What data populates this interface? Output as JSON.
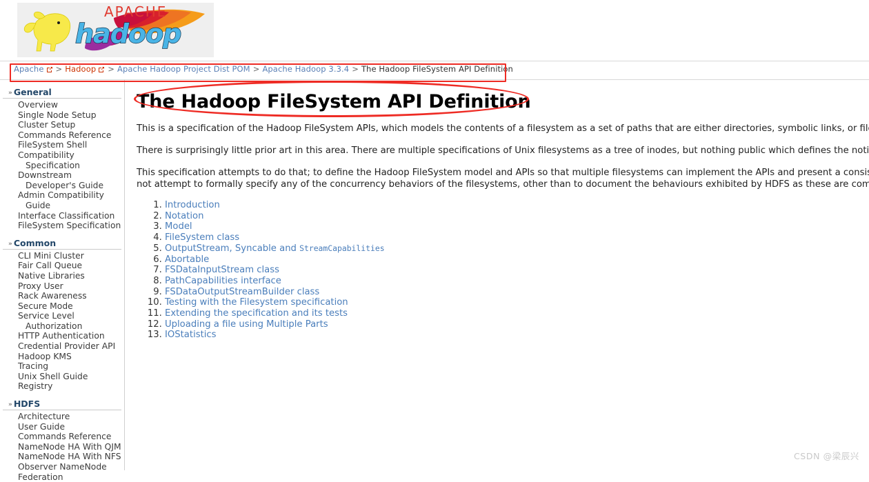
{
  "banner": {
    "logo_alt": "Apache Hadoop",
    "logo_word_apache": "APACHE",
    "logo_word_hadoop": "hadoop",
    "logo_bg": "#efefef",
    "apache_text_color": "#e03a2f",
    "hadoop_text_color": "#4ab4e6",
    "elephant_color": "#f7e94a",
    "feather_colors": [
      "#c8103c",
      "#e8542f",
      "#f59c1a",
      "#f7b733"
    ]
  },
  "breadcrumb": {
    "items": [
      {
        "label": "Apache",
        "style": "blue",
        "external": true
      },
      {
        "label": "Hadoop",
        "style": "red",
        "external": true
      },
      {
        "label": "Apache Hadoop Project Dist POM",
        "style": "blue",
        "external": false
      },
      {
        "label": "Apache Hadoop 3.3.4",
        "style": "blue",
        "external": false
      },
      {
        "label": "The Hadoop FileSystem API Definition",
        "style": "current",
        "external": false
      }
    ],
    "separator": ">",
    "external_icon": "external-link-icon",
    "annotation_color": "#ee2b24"
  },
  "sidebar": {
    "sections": [
      {
        "title": "General",
        "caret": "»",
        "items": [
          {
            "label": "Overview",
            "indent": false
          },
          {
            "label": "Single Node Setup",
            "indent": false
          },
          {
            "label": "Cluster Setup",
            "indent": false
          },
          {
            "label": "Commands Reference",
            "indent": false
          },
          {
            "label": "FileSystem Shell",
            "indent": false
          },
          {
            "label": "Compatibility",
            "indent": false
          },
          {
            "label": "Specification",
            "indent": true
          },
          {
            "label": "Downstream",
            "indent": false
          },
          {
            "label": "Developer's Guide",
            "indent": true
          },
          {
            "label": "Admin Compatibility",
            "indent": false
          },
          {
            "label": "Guide",
            "indent": true
          },
          {
            "label": "Interface Classification",
            "indent": false
          },
          {
            "label": "FileSystem Specification",
            "indent": false
          }
        ]
      },
      {
        "title": "Common",
        "caret": "»",
        "items": [
          {
            "label": "CLI Mini Cluster",
            "indent": false
          },
          {
            "label": "Fair Call Queue",
            "indent": false
          },
          {
            "label": "Native Libraries",
            "indent": false
          },
          {
            "label": "Proxy User",
            "indent": false
          },
          {
            "label": "Rack Awareness",
            "indent": false
          },
          {
            "label": "Secure Mode",
            "indent": false
          },
          {
            "label": "Service Level",
            "indent": false
          },
          {
            "label": "Authorization",
            "indent": true
          },
          {
            "label": "HTTP Authentication",
            "indent": false
          },
          {
            "label": "Credential Provider API",
            "indent": false
          },
          {
            "label": "Hadoop KMS",
            "indent": false
          },
          {
            "label": "Tracing",
            "indent": false
          },
          {
            "label": "Unix Shell Guide",
            "indent": false
          },
          {
            "label": "Registry",
            "indent": false
          }
        ]
      },
      {
        "title": "HDFS",
        "caret": "»",
        "items": [
          {
            "label": "Architecture",
            "indent": false
          },
          {
            "label": "User Guide",
            "indent": false
          },
          {
            "label": "Commands Reference",
            "indent": false
          },
          {
            "label": "NameNode HA With QJM",
            "indent": false
          },
          {
            "label": "NameNode HA With NFS",
            "indent": false
          },
          {
            "label": "Observer NameNode",
            "indent": false
          },
          {
            "label": "Federation",
            "indent": false
          }
        ]
      }
    ]
  },
  "main": {
    "title": "The Hadoop FileSystem API Definition",
    "title_annotation_color": "#ee2b24",
    "paragraphs": [
      "This is a specification of the Hadoop FileSystem APIs, which models the contents of a filesystem as a set of paths that are either directories, symbolic links, or files.",
      "There is surprisingly little prior art in this area. There are multiple specifications of Unix filesystems as a tree of inodes, but nothing public which defines the notion of “Unix filesystem as a tree of inodes”.",
      "This specification attempts to do that; to define the Hadoop FileSystem model and APIs so that multiple filesystems can implement the APIs and present a consistent model of their data to applications. It does not attempt to formally specify any of the concurrency behaviors of the filesystems, other than to document the behaviours exhibited by HDFS as these are commonly expected by Hadoop client applications."
    ],
    "toc": [
      {
        "num": 1,
        "text": "Introduction",
        "code": ""
      },
      {
        "num": 2,
        "text": "Notation",
        "code": ""
      },
      {
        "num": 3,
        "text": "Model",
        "code": ""
      },
      {
        "num": 4,
        "text": "FileSystem class",
        "code": ""
      },
      {
        "num": 5,
        "text": "OutputStream, Syncable and ",
        "code": "StreamCapabilities"
      },
      {
        "num": 6,
        "text": "Abortable",
        "code": ""
      },
      {
        "num": 7,
        "text": "FSDataInputStream class",
        "code": ""
      },
      {
        "num": 8,
        "text": "PathCapabilities interface",
        "code": ""
      },
      {
        "num": 9,
        "text": "FSDataOutputStreamBuilder class",
        "code": ""
      },
      {
        "num": 10,
        "text": "Testing with the Filesystem specification",
        "code": ""
      },
      {
        "num": 11,
        "text": "Extending the specification and its tests",
        "code": ""
      },
      {
        "num": 12,
        "text": "Uploading a file using Multiple Parts",
        "code": ""
      },
      {
        "num": 13,
        "text": "IOStatistics",
        "code": ""
      }
    ],
    "link_color": "#4a7ebb"
  },
  "watermark": {
    "text": "CSDN @梁辰兴",
    "color": "#c9c9c9"
  }
}
